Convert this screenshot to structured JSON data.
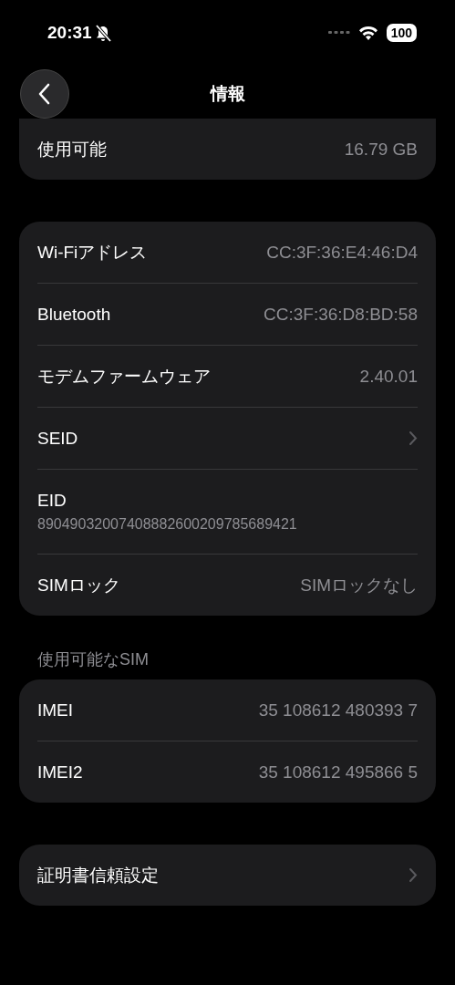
{
  "status_bar": {
    "time": "20:31",
    "silent": true,
    "battery": "100"
  },
  "nav": {
    "title": "情報"
  },
  "sections": [
    {
      "rows": [
        {
          "kind": "value",
          "label": "使用可能",
          "value": "16.79 GB"
        }
      ]
    },
    {
      "rows": [
        {
          "kind": "value",
          "label": "Wi-Fiアドレス",
          "value": "CC:3F:36:E4:46:D4"
        },
        {
          "kind": "value",
          "label": "Bluetooth",
          "value": "CC:3F:36:D8:BD:58"
        },
        {
          "kind": "value",
          "label": "モデムファームウェア",
          "value": "2.40.01"
        },
        {
          "kind": "link",
          "label": "SEID"
        },
        {
          "kind": "stacked",
          "label": "EID",
          "value": "89049032007408882600209785689421"
        },
        {
          "kind": "value",
          "label": "SIMロック",
          "value": "SIMロックなし"
        }
      ]
    },
    {
      "header": "使用可能なSIM",
      "rows": [
        {
          "kind": "value",
          "label": "IMEI",
          "value": "35 108612 480393 7"
        },
        {
          "kind": "value",
          "label": "IMEI2",
          "value": "35 108612 495866 5"
        }
      ]
    },
    {
      "rows": [
        {
          "kind": "link",
          "label": "証明書信頼設定"
        }
      ]
    }
  ]
}
